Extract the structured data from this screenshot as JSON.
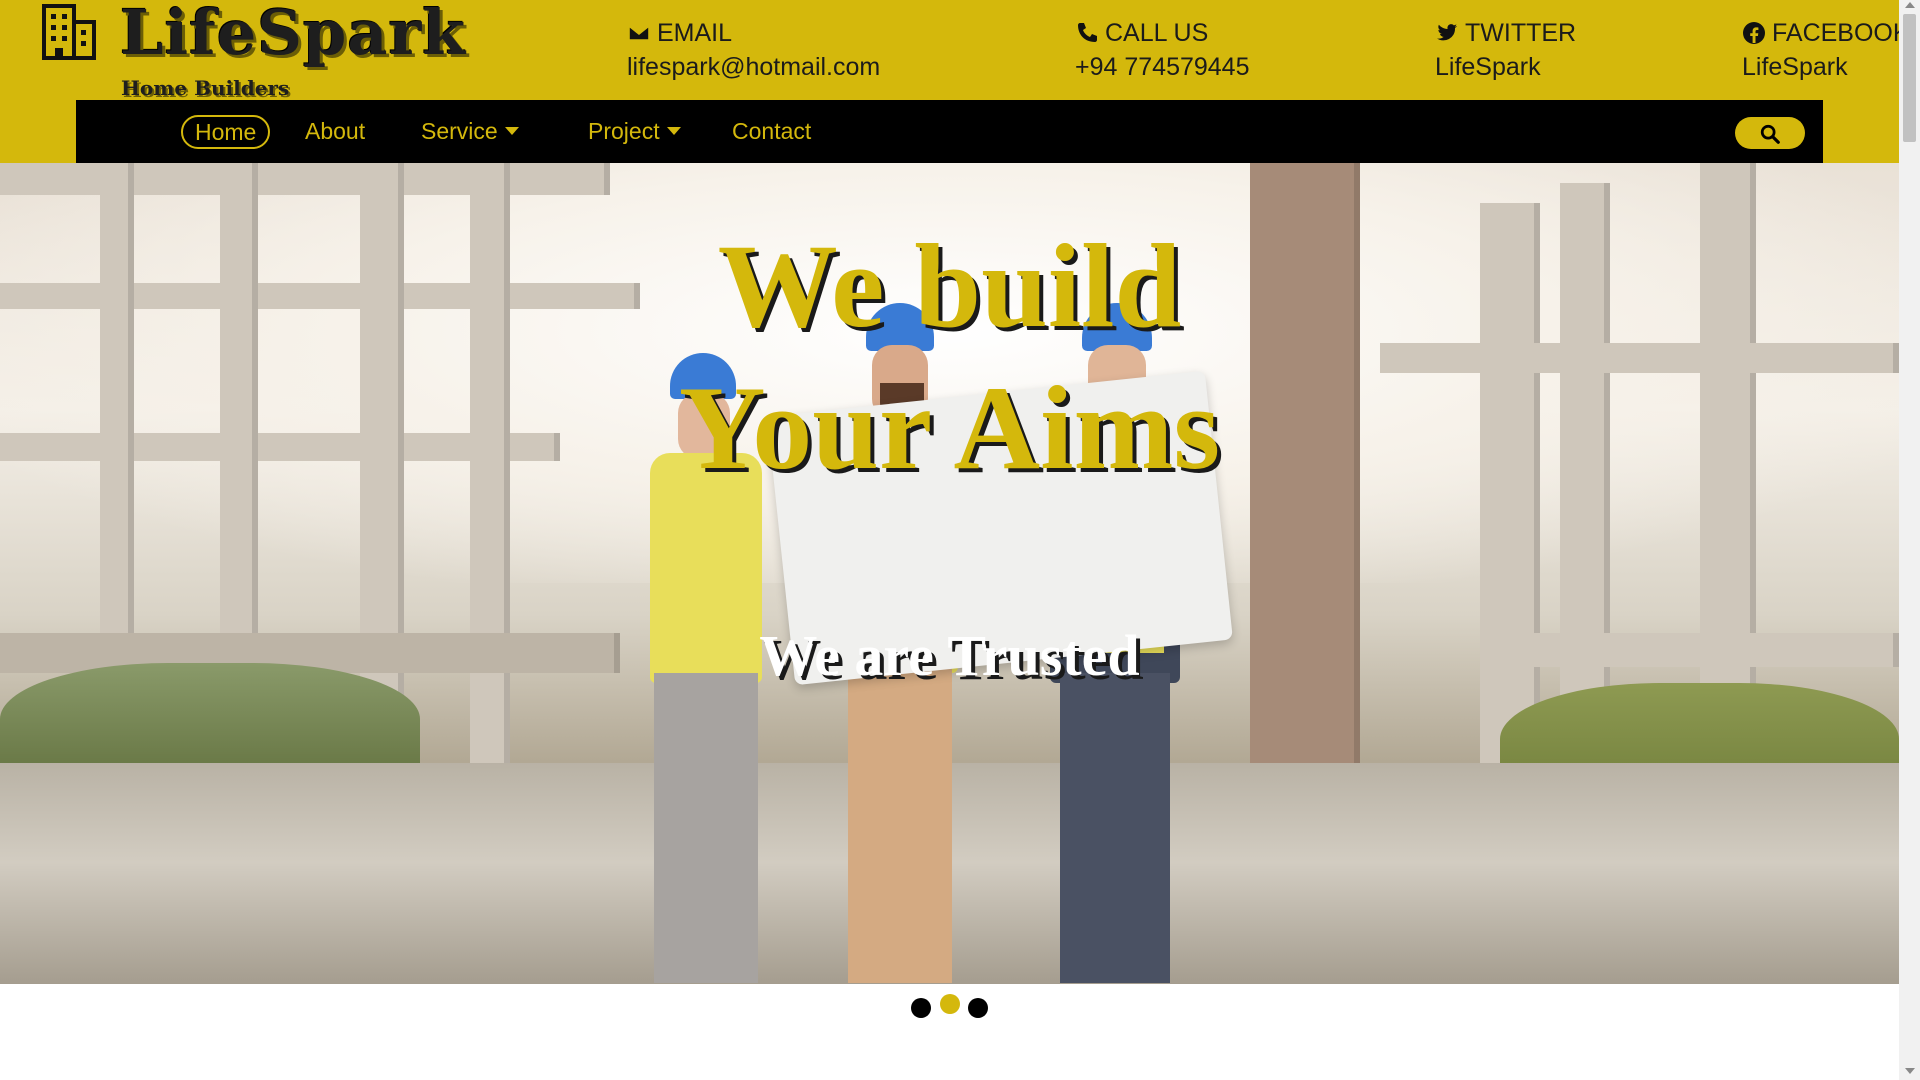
{
  "brand": {
    "title": "LifeSpark",
    "subtitle": "Home Builders",
    "icon": "building-icon"
  },
  "contacts": [
    {
      "label": "EMAIL",
      "value": "lifespark@hotmail.com",
      "icon": "envelope-icon"
    },
    {
      "label": "CALL US",
      "value": "+94 774579445",
      "icon": "phone-icon"
    },
    {
      "label": "TWITTER",
      "value": "LifeSpark",
      "icon": "twitter-icon"
    },
    {
      "label": "FACEBOOK",
      "value": "LifeSpark",
      "icon": "facebook-icon"
    }
  ],
  "nav": {
    "items": [
      {
        "label": "Home",
        "active": true
      },
      {
        "label": "About"
      },
      {
        "label": "Service",
        "dropdown": true
      },
      {
        "label": "Project",
        "dropdown": true
      },
      {
        "label": "Contact"
      }
    ],
    "search_icon": "search-icon"
  },
  "hero": {
    "line1": "We build",
    "line2": "Your Aims",
    "subtitle": "We are Trusted"
  },
  "carousel": {
    "slides": 3,
    "active_index": 1
  },
  "colors": {
    "accent": "#d4b80c",
    "nav_bg": "#000000",
    "text_dark": "#1b1b1b"
  }
}
